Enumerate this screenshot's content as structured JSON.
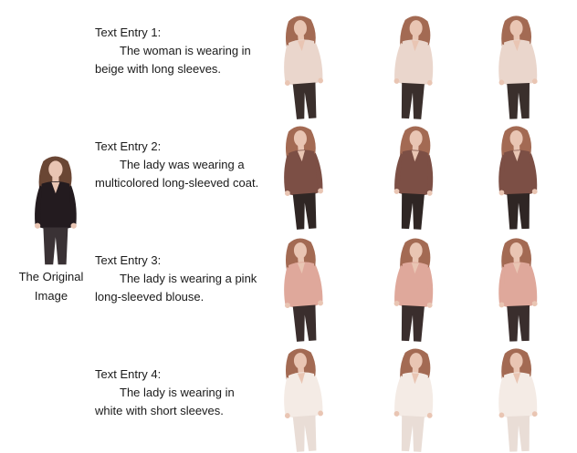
{
  "original": {
    "caption_line1": "The Original",
    "caption_line2": "Image",
    "top_color": "#231b1f",
    "pants_color": "#3a3235"
  },
  "entries": [
    {
      "title": "Text Entry 1:",
      "text": "The woman is wearing in beige with long sleeves.",
      "garment_color": "#ead6cc",
      "pants_color": "#3a2f2c"
    },
    {
      "title": "Text Entry 2:",
      "text": "The lady was wearing a multicolored long-sleeved coat.",
      "garment_color": "#7c4f45",
      "pants_color": "#2f2624"
    },
    {
      "title": "Text Entry 3:",
      "text": "The lady is wearing a pink long-sleeved blouse.",
      "garment_color": "#dfa89b",
      "pants_color": "#3a2e2d"
    },
    {
      "title": "Text Entry 4:",
      "text": "The lady is wearing in white with short sleeves.",
      "garment_color": "#f4ebe5",
      "pants_color": "#e9ddd6"
    }
  ],
  "palette": {
    "skin": "#e9c5b3",
    "hair": "#a36a53"
  }
}
